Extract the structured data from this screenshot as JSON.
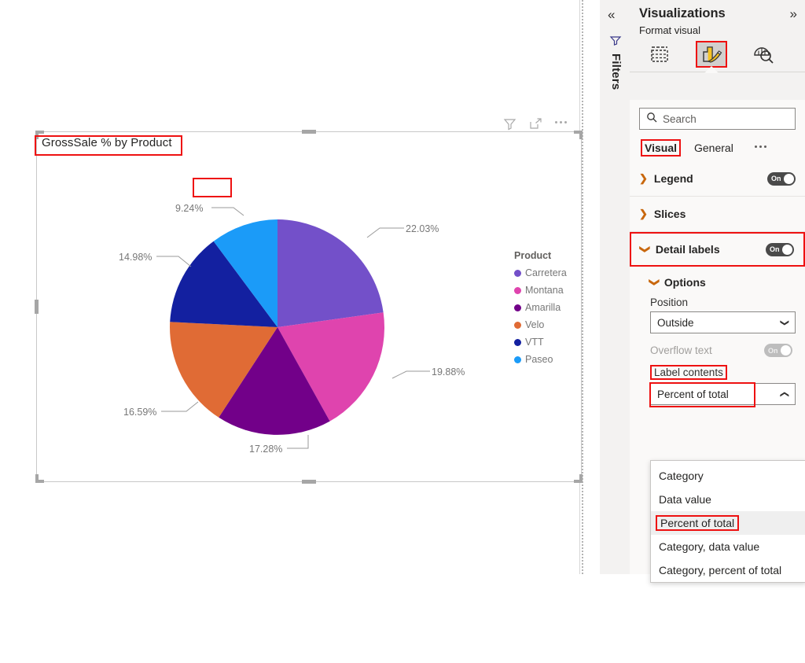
{
  "canvas": {
    "visual_title": "GrossSale % by Product",
    "toolbar": [
      {
        "name": "filter-icon",
        "label": "Filters"
      },
      {
        "name": "focus-mode-icon",
        "label": "Focus mode"
      },
      {
        "name": "more-options-icon",
        "label": "More options"
      }
    ]
  },
  "chart_data": {
    "type": "pie",
    "title": "GrossSale % by Product",
    "legend_title": "Product",
    "legend_position": "right",
    "label_format": "Percent of total",
    "categories": [
      "Carretera",
      "Montana",
      "Amarilla",
      "Velo",
      "VTT",
      "Paseo"
    ],
    "values": [
      22.03,
      19.88,
      17.28,
      16.59,
      14.98,
      9.24
    ],
    "labels": [
      "22.03%",
      "19.88%",
      "17.28%",
      "16.59%",
      "14.98%",
      "9.24%"
    ],
    "colors": [
      "#7350c9",
      "#df44ae",
      "#720089",
      "#e06b35",
      "#1320a0",
      "#1b9bf8"
    ],
    "ylabel": "",
    "xlabel": ""
  },
  "filters_rail": {
    "collapse_label": "«",
    "icon": "filter-icon",
    "title": "Filters"
  },
  "viz_pane": {
    "title": "Visualizations",
    "expand_label": "»",
    "subtitle": "Format visual",
    "icons": [
      {
        "name": "build-visual-icon",
        "label": "Build visual",
        "selected": false
      },
      {
        "name": "format-visual-icon",
        "label": "Format visual",
        "selected": true
      },
      {
        "name": "analytics-icon",
        "label": "Analytics",
        "selected": false
      }
    ],
    "search_placeholder": "Search",
    "tabs": [
      {
        "label": "Visual",
        "selected": true
      },
      {
        "label": "General",
        "selected": false
      }
    ],
    "tabs_more": "…",
    "sections": [
      {
        "label": "Legend",
        "expanded": false,
        "toggle": "On",
        "toggle_on": true
      },
      {
        "label": "Slices",
        "expanded": false,
        "toggle": null,
        "toggle_on": false
      },
      {
        "label": "Detail labels",
        "expanded": true,
        "toggle": "On",
        "toggle_on": true,
        "highlighted": true
      }
    ],
    "detail_labels": {
      "options_title": "Options",
      "position_label": "Position",
      "position_value": "Outside",
      "overflow_label": "Overflow text",
      "overflow_toggle": "On",
      "label_contents_label": "Label contents",
      "label_contents_value": "Percent of total",
      "dropdown_options": [
        {
          "label": "Category",
          "selected": false
        },
        {
          "label": "Data value",
          "selected": false
        },
        {
          "label": "Percent of total",
          "selected": true
        },
        {
          "label": "Category, data value",
          "selected": false
        },
        {
          "label": "Category, percent of total",
          "selected": false
        }
      ]
    }
  },
  "highlight_color": "#ee1111"
}
